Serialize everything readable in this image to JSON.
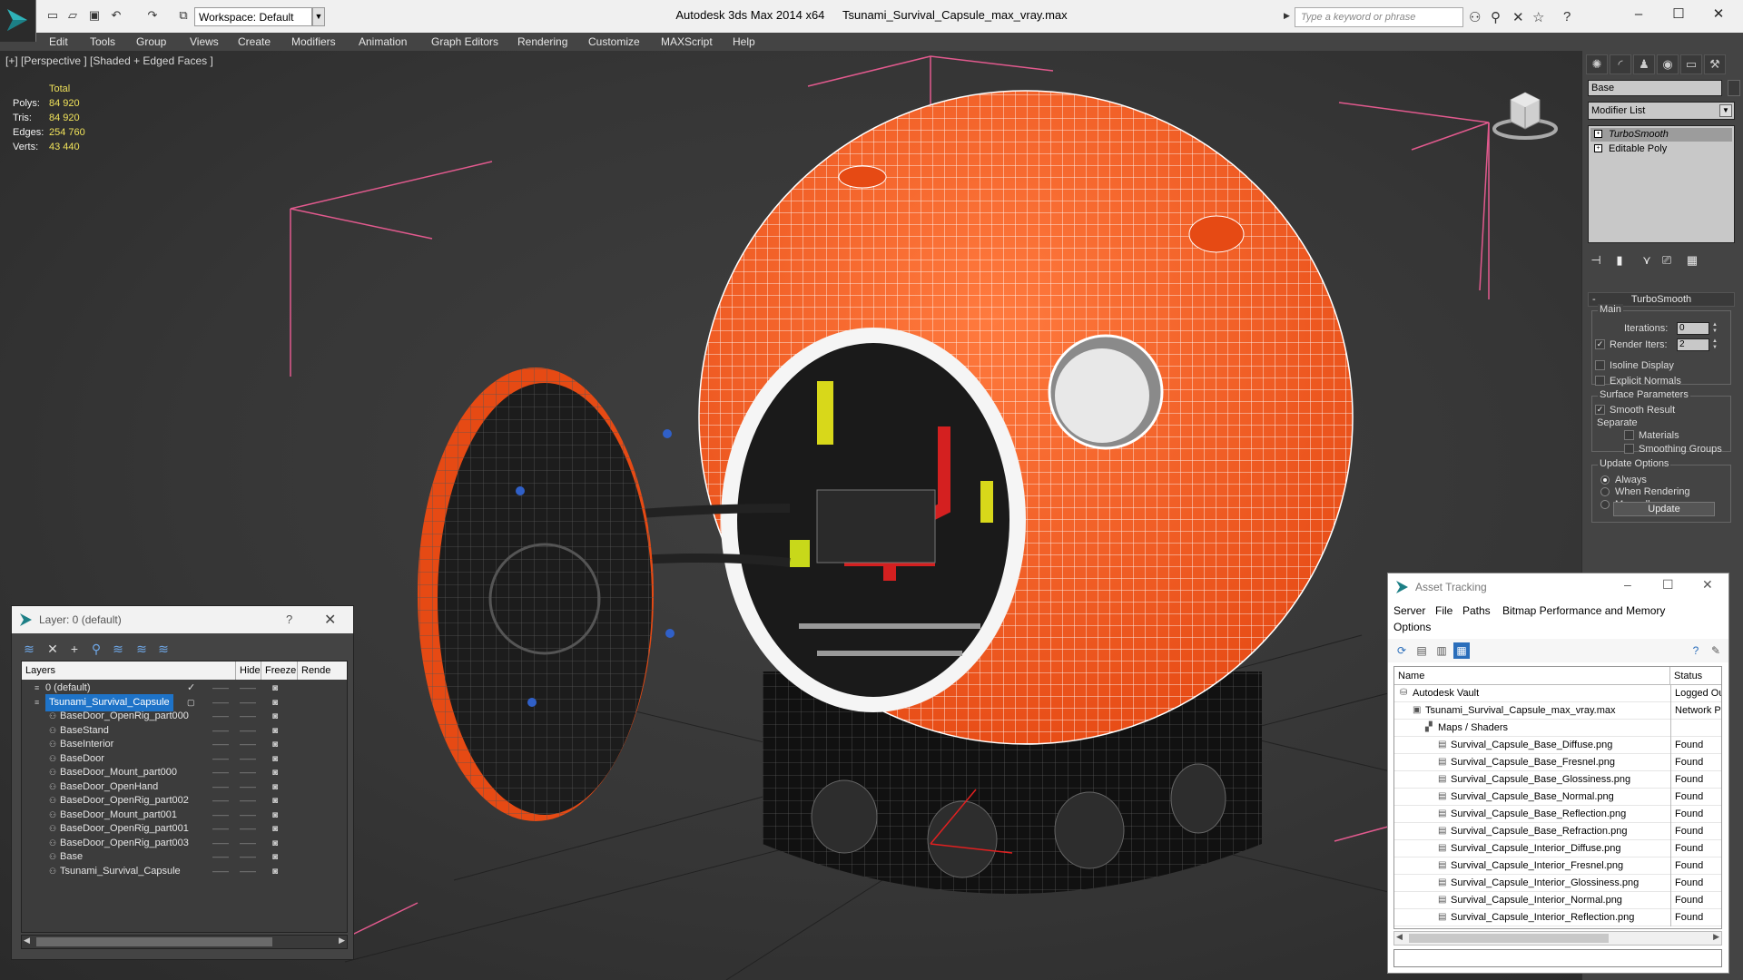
{
  "titlebar": {
    "app_name": "Autodesk 3ds Max  2014 x64",
    "file_name": "Tsunami_Survival_Capsule_max_vray.max",
    "workspace_label": "Workspace: Default",
    "search_placeholder": "Type a keyword or phrase"
  },
  "menu": [
    "Edit",
    "Tools",
    "Group",
    "Views",
    "Create",
    "Modifiers",
    "Animation",
    "Graph Editors",
    "Rendering",
    "Customize",
    "MAXScript",
    "Help"
  ],
  "viewport": {
    "label": "[+] [Perspective ] [Shaded + Edged Faces ]",
    "stats": {
      "total_label": "Total",
      "polys_label": "Polys:",
      "polys": "84 920",
      "tris_label": "Tris:",
      "tris": "84 920",
      "edges_label": "Edges:",
      "edges": "254 760",
      "verts_label": "Verts:",
      "verts": "43 440"
    },
    "colors": {
      "shell": "#f0541e",
      "wire": "#ffffff",
      "frame": "#e25a8e",
      "base": "#111111"
    }
  },
  "command_panel": {
    "object_name": "Base",
    "modifier_list": "Modifier List",
    "stack": [
      "TurboSmooth",
      "Editable Poly"
    ],
    "rollout_title": "TurboSmooth",
    "main_group": "Main",
    "iterations_label": "Iterations:",
    "iterations_value": "0",
    "render_iters_label": "Render Iters:",
    "render_iters_value": "2",
    "isoline_label": "Isoline Display",
    "explicit_normals_label": "Explicit Normals",
    "surface_params_label": "Surface Parameters",
    "smooth_result_label": "Smooth Result",
    "separate_label": "Separate",
    "materials_label": "Materials",
    "smoothing_groups_label": "Smoothing Groups",
    "update_options_label": "Update Options",
    "always_label": "Always",
    "when_rendering_label": "When Rendering",
    "manually_label": "Manually",
    "update_button": "Update"
  },
  "layer_dialog": {
    "title": "Layer: 0 (default)",
    "help": "?",
    "columns": [
      "Layers",
      "Hide",
      "Freeze",
      "Rende"
    ],
    "rows": [
      {
        "name": "0 (default)",
        "level": 0,
        "selected": false
      },
      {
        "name": "Tsunami_Survival_Capsule",
        "level": 0,
        "selected": true
      },
      {
        "name": "BaseDoor_OpenRig_part000",
        "level": 1,
        "selected": false
      },
      {
        "name": "BaseStand",
        "level": 1,
        "selected": false
      },
      {
        "name": "BaseInterior",
        "level": 1,
        "selected": false
      },
      {
        "name": "BaseDoor",
        "level": 1,
        "selected": false
      },
      {
        "name": "BaseDoor_Mount_part000",
        "level": 1,
        "selected": false
      },
      {
        "name": "BaseDoor_OpenHand",
        "level": 1,
        "selected": false
      },
      {
        "name": "BaseDoor_OpenRig_part002",
        "level": 1,
        "selected": false
      },
      {
        "name": "BaseDoor_Mount_part001",
        "level": 1,
        "selected": false
      },
      {
        "name": "BaseDoor_OpenRig_part001",
        "level": 1,
        "selected": false
      },
      {
        "name": "BaseDoor_OpenRig_part003",
        "level": 1,
        "selected": false
      },
      {
        "name": "Base",
        "level": 1,
        "selected": false
      },
      {
        "name": "Tsunami_Survival_Capsule",
        "level": 1,
        "selected": false
      }
    ]
  },
  "asset_dialog": {
    "title": "Asset Tracking",
    "menu": [
      "Server",
      "File",
      "Paths",
      "Bitmap Performance and Memory",
      "Options"
    ],
    "columns": [
      "Name",
      "Status"
    ],
    "rows": [
      {
        "name": "Autodesk Vault",
        "status": "Logged Ou",
        "level": 0
      },
      {
        "name": "Tsunami_Survival_Capsule_max_vray.max",
        "status": "Network P",
        "level": 1
      },
      {
        "name": "Maps / Shaders",
        "status": "",
        "level": 2
      },
      {
        "name": "Survival_Capsule_Base_Diffuse.png",
        "status": "Found",
        "level": 3
      },
      {
        "name": "Survival_Capsule_Base_Fresnel.png",
        "status": "Found",
        "level": 3
      },
      {
        "name": "Survival_Capsule_Base_Glossiness.png",
        "status": "Found",
        "level": 3
      },
      {
        "name": "Survival_Capsule_Base_Normal.png",
        "status": "Found",
        "level": 3
      },
      {
        "name": "Survival_Capsule_Base_Reflection.png",
        "status": "Found",
        "level": 3
      },
      {
        "name": "Survival_Capsule_Base_Refraction.png",
        "status": "Found",
        "level": 3
      },
      {
        "name": "Survival_Capsule_Interior_Diffuse.png",
        "status": "Found",
        "level": 3
      },
      {
        "name": "Survival_Capsule_Interior_Fresnel.png",
        "status": "Found",
        "level": 3
      },
      {
        "name": "Survival_Capsule_Interior_Glossiness.png",
        "status": "Found",
        "level": 3
      },
      {
        "name": "Survival_Capsule_Interior_Normal.png",
        "status": "Found",
        "level": 3
      },
      {
        "name": "Survival_Capsule_Interior_Reflection.png",
        "status": "Found",
        "level": 3
      }
    ]
  }
}
